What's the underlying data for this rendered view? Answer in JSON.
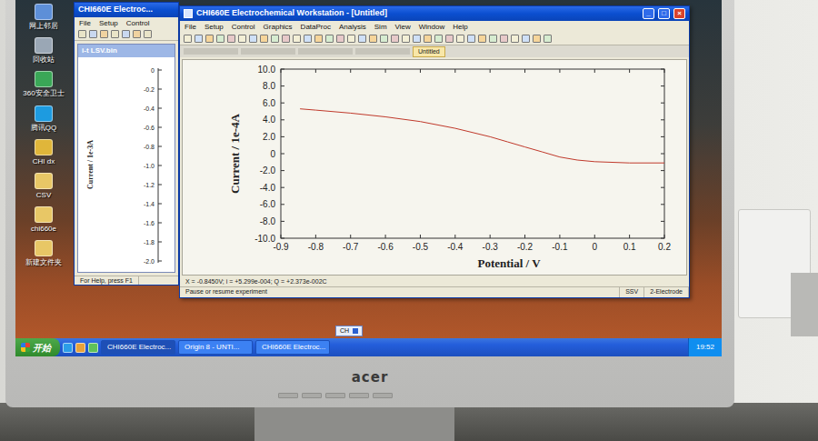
{
  "desktop_icons": [
    {
      "label": "网上邻居"
    },
    {
      "label": "回收站"
    },
    {
      "label": "360安全卫士"
    },
    {
      "label": "腾讯QQ"
    },
    {
      "label": "CHI dx"
    },
    {
      "label": "CSV"
    },
    {
      "label": "chi660e"
    },
    {
      "label": "新建文件夹"
    }
  ],
  "back_window": {
    "title": "CHI660E Electroc...",
    "menu": [
      "File",
      "Setup",
      "Control"
    ],
    "child_title": "i-t LSV.bin",
    "y_label": "Current / 1e-3A",
    "y_ticks": [
      "0",
      "-0.2",
      "-0.4",
      "-0.6",
      "-0.8",
      "-1.0",
      "-1.2",
      "-1.4",
      "-1.6",
      "-1.8",
      "-2.0"
    ],
    "status": "For Help, press F1"
  },
  "main_window": {
    "title": "CHI660E Electrochemical Workstation - [Untitled]",
    "buttons": [
      "_",
      "□",
      "×"
    ],
    "menu": [
      "File",
      "Setup",
      "Control",
      "Graphics",
      "DataProc",
      "Analysis",
      "Sim",
      "View",
      "Window",
      "Help"
    ],
    "tabs": [
      {
        "label": "Untitled",
        "selected": true
      }
    ],
    "readout": "X = -0.8450V; i = +5.299e-004; Q = +2.373e-002C",
    "status": [
      "Pause or resume experiment",
      "SSV",
      "2-Electrode"
    ]
  },
  "chart": {
    "y_label": "Current / 1e-4A",
    "x_label": "Potential / V",
    "y_ticks": [
      "10.0",
      "8.0",
      "6.0",
      "4.0",
      "2.0",
      "0",
      "-2.0",
      "-4.0",
      "-6.0",
      "-8.0",
      "-10.0"
    ],
    "x_ticks": [
      "-0.9",
      "-0.8",
      "-0.7",
      "-0.6",
      "-0.5",
      "-0.4",
      "-0.3",
      "-0.2",
      "-0.1",
      "0",
      "0.1",
      "0.2"
    ],
    "series": [
      {
        "x": [
          -0.845,
          -0.8,
          -0.7,
          -0.6,
          -0.5,
          -0.4,
          -0.3,
          -0.25,
          -0.2,
          -0.15,
          -0.1,
          -0.05,
          0,
          0.1,
          0.2
        ],
        "y": [
          5.3,
          5.15,
          4.8,
          4.35,
          3.8,
          3.0,
          2.0,
          1.4,
          0.8,
          0.2,
          -0.4,
          -0.75,
          -0.95,
          -1.1,
          -1.1
        ]
      }
    ]
  },
  "taskbar": {
    "start": "开始",
    "tasks": [
      {
        "label": "CHI660E Electroc...",
        "selected": true
      },
      {
        "label": "Origin 8 - UNTI...",
        "selected": false
      },
      {
        "label": "CHI660E Electroc...",
        "selected": false
      }
    ],
    "lang": "CH",
    "clock": "19:52"
  },
  "monitor": {
    "brand": "acer"
  }
}
